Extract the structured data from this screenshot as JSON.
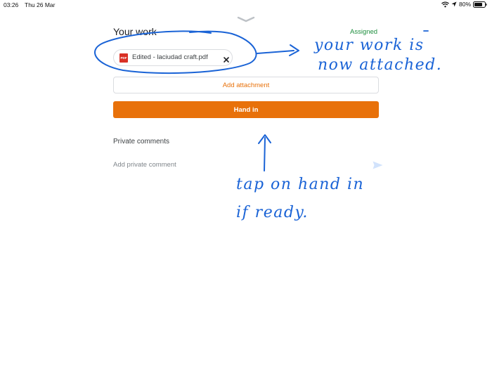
{
  "status_bar": {
    "time": "03:26",
    "date": "Thu 26 Mar",
    "battery": "80%"
  },
  "your_work": {
    "title": "Your work",
    "status": "Assigned",
    "attachment": {
      "badge": "PDF",
      "name": "Edited - laciudad craft.pdf"
    },
    "add_attachment_label": "Add attachment",
    "hand_in_label": "Hand in"
  },
  "private_comments": {
    "title": "Private comments",
    "placeholder": "Add private comment"
  },
  "annotations": {
    "line1": "your work is",
    "line2": "now attached.",
    "line3": "tap on hand in",
    "line4": "if ready."
  },
  "colors": {
    "accent": "#e8710a",
    "assigned": "#1e8e3e",
    "ink": "#1a63d6"
  },
  "icons": {
    "wifi": "wifi-icon",
    "location": "location-arrow-icon",
    "battery": "battery-icon",
    "handle": "chevron-down-icon",
    "file": "pdf-icon",
    "remove": "close-icon",
    "send": "send-icon"
  }
}
